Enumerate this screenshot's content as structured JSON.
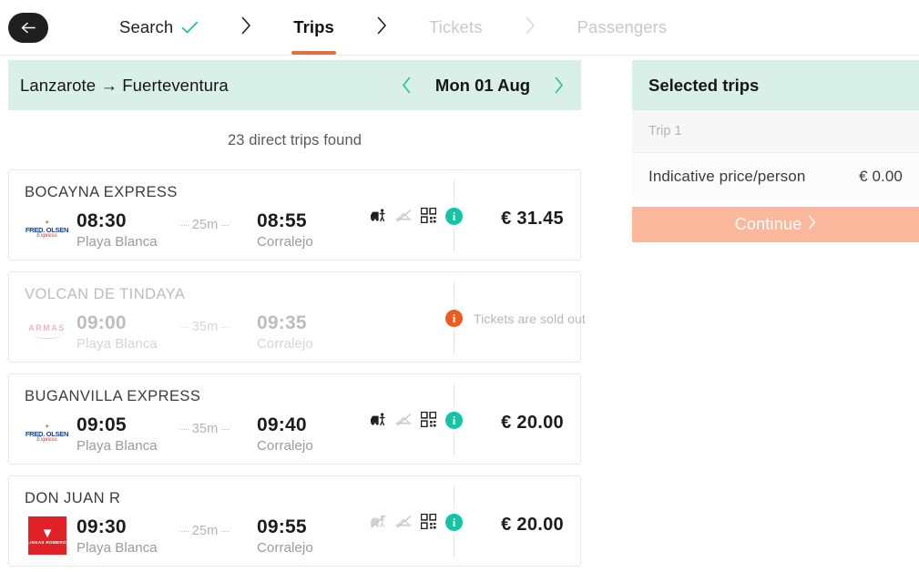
{
  "nav": {
    "back_icon": "arrow-left-icon",
    "steps": [
      {
        "label": "Search",
        "state": "done",
        "check_icon": "check-icon"
      },
      {
        "label": "Trips",
        "state": "active"
      },
      {
        "label": "Tickets",
        "state": "muted"
      },
      {
        "label": "Passengers",
        "state": "muted"
      }
    ],
    "separator_icon": "chevron-right-icon",
    "active_underline_color": "#e0703c",
    "check_color": "#15c3a5"
  },
  "route_bar": {
    "origin": "Lanzarote",
    "destination": "Fuerteventura",
    "arrow": "→",
    "route_text": "Lanzarote → Fuerteventura",
    "prev_icon": "chevron-left-icon",
    "next_icon": "chevron-right-icon",
    "date": "Mon 01 Aug",
    "background": "#d9f0e9"
  },
  "results": {
    "count_text": "23 direct trips found",
    "trips": [
      {
        "vessel": "BOCAYNA EXPRESS",
        "operator_logo": "fred-olsen-express-logo",
        "logo_text": {
          "mark": "✦",
          "name": "FRED. OLSEN",
          "sub": "Express"
        },
        "depart_time": "08:30",
        "depart_port": "Playa Blanca",
        "arrive_time": "08:55",
        "arrive_port": "Corralejo",
        "duration": "25m",
        "amenities": [
          {
            "name": "vehicle-icon",
            "enabled": true
          },
          {
            "name": "no-meal-icon",
            "enabled": false
          },
          {
            "name": "qr-ticket-icon",
            "enabled": true
          }
        ],
        "info_icon": "info-icon",
        "info_state": "available",
        "price": "€ 31.45",
        "sold_out": false,
        "status_text": ""
      },
      {
        "vessel": "VOLCAN DE TINDAYA",
        "operator_logo": "armas-logo",
        "logo_text": {
          "name": "ARMAS"
        },
        "depart_time": "09:00",
        "depart_port": "Playa Blanca",
        "arrive_time": "09:35",
        "arrive_port": "Corralejo",
        "duration": "35m",
        "amenities": [],
        "info_icon": "info-icon",
        "info_state": "warning",
        "price": "",
        "sold_out": true,
        "status_text": "Tickets are sold out"
      },
      {
        "vessel": "BUGANVILLA EXPRESS",
        "operator_logo": "fred-olsen-express-logo",
        "logo_text": {
          "mark": "✦",
          "name": "FRED. OLSEN",
          "sub": "Express"
        },
        "depart_time": "09:05",
        "depart_port": "Playa Blanca",
        "arrive_time": "09:40",
        "arrive_port": "Corralejo",
        "duration": "35m",
        "amenities": [
          {
            "name": "vehicle-icon",
            "enabled": true
          },
          {
            "name": "no-meal-icon",
            "enabled": false
          },
          {
            "name": "qr-ticket-icon",
            "enabled": true
          }
        ],
        "info_icon": "info-icon",
        "info_state": "available",
        "price": "€ 20.00",
        "sold_out": false,
        "status_text": ""
      },
      {
        "vessel": "DON JUAN R",
        "operator_logo": "lineas-romero-logo",
        "logo_text": {
          "mark": "▼",
          "name": "LINEAS ROMERO"
        },
        "depart_time": "09:30",
        "depart_port": "Playa Blanca",
        "arrive_time": "09:55",
        "arrive_port": "Corralejo",
        "duration": "25m",
        "amenities": [
          {
            "name": "vehicle-icon",
            "enabled": false
          },
          {
            "name": "no-meal-icon",
            "enabled": false
          },
          {
            "name": "qr-ticket-icon",
            "enabled": true
          }
        ],
        "info_icon": "info-icon",
        "info_state": "available",
        "price": "€ 20.00",
        "sold_out": false,
        "status_text": ""
      }
    ]
  },
  "sidebar": {
    "title": "Selected trips",
    "trip_row_label": "Trip 1",
    "price_label": "Indicative price/person",
    "price_value": "€ 0.00",
    "continue_label": "Continue",
    "continue_icon": "chevron-right-icon",
    "continue_color": "#fbb89c",
    "header_color": "#d9f0e9"
  }
}
